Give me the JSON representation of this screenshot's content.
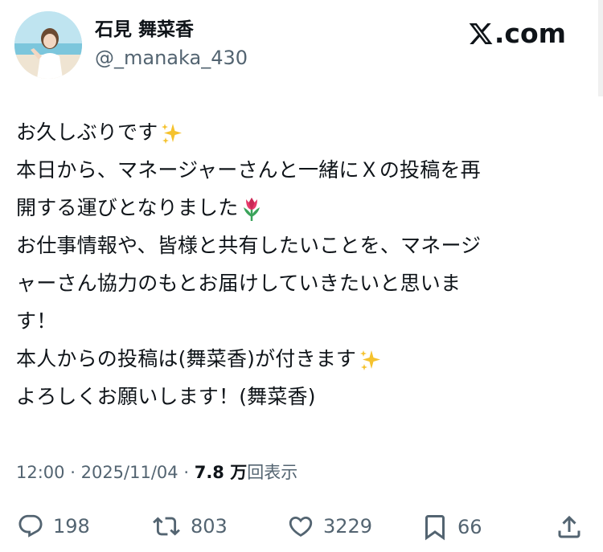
{
  "profile": {
    "display_name": "石見 舞菜香",
    "handle": "@_manaka_430"
  },
  "brand": {
    "logo_text": ".com"
  },
  "tweet": {
    "lines": [
      "お久しぶりです",
      "本日から、マネージャーさんと一緒にＸの投稿を再",
      "開する運びとなりました",
      "お仕事情報や、皆様と共有したいことを、マネージ",
      "ャーさん協力のもとお届けしていきたいと思いま",
      "す！",
      "本人からの投稿は(舞菜香)が付きます",
      "よろしくお願いします！(舞菜香)"
    ],
    "emojis": {
      "line0": "sparkles",
      "line2": "tulip",
      "line6": "sparkles"
    }
  },
  "meta": {
    "time": "12:00",
    "sep": "·",
    "date": "2025/11/04",
    "views_count": "7.8 万",
    "views_label": "回表示"
  },
  "actions": {
    "replies": "198",
    "reposts": "803",
    "likes": "3229",
    "bookmarks": "66"
  },
  "colors": {
    "text": "#0f1419",
    "secondary": "#536471",
    "sparkle": "#f5c22e",
    "tulip": "#e63a6a"
  }
}
